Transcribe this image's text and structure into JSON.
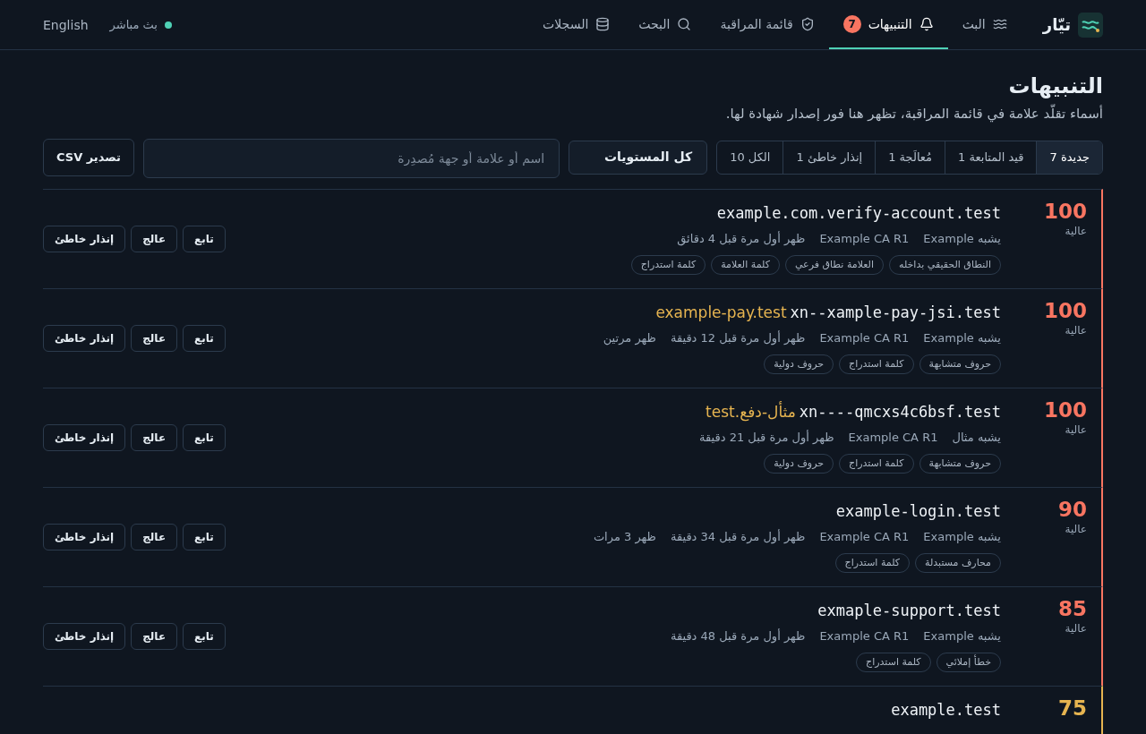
{
  "brand": {
    "name": "تيّار"
  },
  "nav": [
    {
      "label": "البث",
      "kind": "waves",
      "selected": false
    },
    {
      "label": "التنبيهات",
      "kind": "bell",
      "selected": true,
      "badge": "7"
    },
    {
      "label": "قائمة المراقبة",
      "kind": "shield",
      "selected": false
    },
    {
      "label": "البحث",
      "kind": "search",
      "selected": false
    },
    {
      "label": "السجلات",
      "kind": "database",
      "selected": false
    }
  ],
  "live": {
    "label": "بث مباشر",
    "on": true
  },
  "language": "English",
  "page": {
    "title": "التنبيهات",
    "subtitle": "أسماء تقلّد علامة في قائمة المراقبة، تظهر هنا فور إصدار شهادة لها."
  },
  "filters": [
    {
      "label": "جديدة",
      "count": "7",
      "selected": true
    },
    {
      "label": "قيد المتابعة",
      "count": "1",
      "selected": false
    },
    {
      "label": "مُعالَجة",
      "count": "1",
      "selected": false
    },
    {
      "label": "إنذار خاطئ",
      "count": "1",
      "selected": false
    },
    {
      "label": "الكل",
      "count": "10",
      "selected": false
    }
  ],
  "level_select": {
    "value": "كل المستويات"
  },
  "search": {
    "placeholder": "اسم أو علامة أو جهة مُصدِرة"
  },
  "export_button": "تصدير CSV",
  "alerts": [
    {
      "score": "100",
      "severity": "عالية",
      "color": "#f87561",
      "domain": "example.com.verify-account.test",
      "meta": [
        "يشبه Example",
        "Example CA R1",
        "ظهر أول مرة قبل 4 دقائق"
      ],
      "tags": [
        "النطاق الحقيقي بداخله",
        "العلامة نطاق فرعي",
        "كلمة العلامة",
        "كلمة استدراج"
      ],
      "actions": [
        "تابع",
        "عالج",
        "إنذار خاطئ"
      ]
    },
    {
      "score": "100",
      "severity": "عالية",
      "color": "#f87561",
      "domain": "xn--xample-pay-jsi.test",
      "unicode": "example-pay.test",
      "meta": [
        "يشبه Example",
        "Example CA R1",
        "ظهر أول مرة قبل 12 دقيقة",
        "ظهر مرتين"
      ],
      "tags": [
        "حروف متشابهة",
        "كلمة استدراج",
        "حروف دولية"
      ],
      "actions": [
        "تابع",
        "عالج",
        "إنذار خاطئ"
      ]
    },
    {
      "score": "100",
      "severity": "عالية",
      "color": "#f87561",
      "domain": "xn----qmcxs4c6bsf.test",
      "unicode": "مثأل-دفع.test",
      "meta": [
        "يشبه مثال",
        "Example CA R1",
        "ظهر أول مرة قبل 21 دقيقة"
      ],
      "tags": [
        "حروف متشابهة",
        "كلمة استدراج",
        "حروف دولية"
      ],
      "actions": [
        "تابع",
        "عالج",
        "إنذار خاطئ"
      ]
    },
    {
      "score": "90",
      "severity": "عالية",
      "color": "#f87561",
      "domain": "example-login.test",
      "meta": [
        "يشبه Example",
        "Example CA R1",
        "ظهر أول مرة قبل 34 دقيقة",
        "ظهر 3 مرات"
      ],
      "tags": [
        "محارف مستبدلة",
        "كلمة استدراج"
      ],
      "actions": [
        "تابع",
        "عالج",
        "إنذار خاطئ"
      ]
    },
    {
      "score": "85",
      "severity": "عالية",
      "color": "#f87561",
      "domain": "exmaple-support.test",
      "meta": [
        "يشبه Example",
        "Example CA R1",
        "ظهر أول مرة قبل 48 دقيقة"
      ],
      "tags": [
        "خطأ إملائي",
        "كلمة استدراج"
      ],
      "actions": [
        "تابع",
        "عالج",
        "إنذار خاطئ"
      ]
    },
    {
      "score": "75",
      "color": "#e6b450",
      "domain": "example.test"
    }
  ]
}
